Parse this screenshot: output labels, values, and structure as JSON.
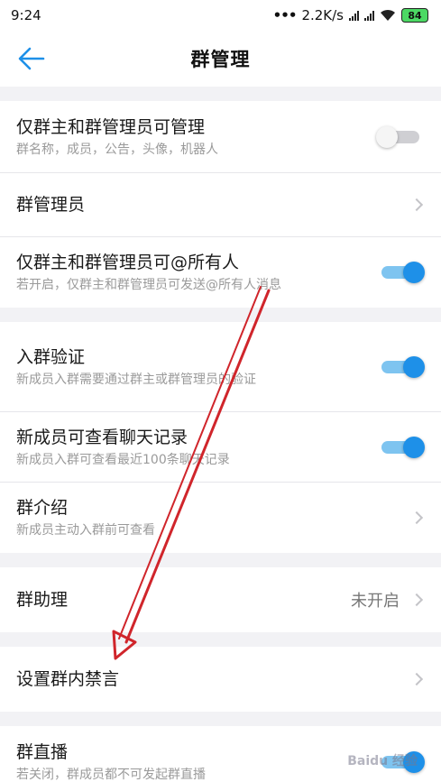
{
  "status_bar": {
    "time": "9:24",
    "net_speed": "2.2K/s",
    "battery": "84"
  },
  "nav": {
    "title": "群管理",
    "back_icon": "arrow-left-icon"
  },
  "colors": {
    "accent": "#1e90e8",
    "toggle_track_on": "#7ec4f0",
    "annotation_arrow": "#d0252b"
  },
  "groups": [
    {
      "items": [
        {
          "title": "仅群主和群管理员可管理",
          "subtitle": "群名称，成员，公告，头像，机器人",
          "toggle": "off"
        },
        {
          "title": "群管理员",
          "chevron": true
        },
        {
          "title": "仅群主和群管理员可@所有人",
          "subtitle": "若开启，仅群主和群管理员可发送@所有人消息",
          "toggle": "on"
        }
      ]
    },
    {
      "items": [
        {
          "title": "入群验证",
          "subtitle": "新成员入群需要通过群主或群管理员的验证",
          "toggle": "on"
        },
        {
          "title": "新成员可查看聊天记录",
          "subtitle": "新成员入群可查看最近100条聊天记录",
          "toggle": "on"
        },
        {
          "title": "群介绍",
          "subtitle": "新成员主动入群前可查看",
          "chevron": true
        }
      ]
    },
    {
      "items": [
        {
          "title": "群助理",
          "value": "未开启",
          "chevron": true
        }
      ]
    },
    {
      "items": [
        {
          "title": "设置群内禁言",
          "chevron": true
        }
      ]
    },
    {
      "items": [
        {
          "title": "群直播",
          "subtitle": "若关闭，群成员都不可发起群直播",
          "toggle": "on"
        }
      ]
    }
  ],
  "watermark": "Baidu 经验"
}
